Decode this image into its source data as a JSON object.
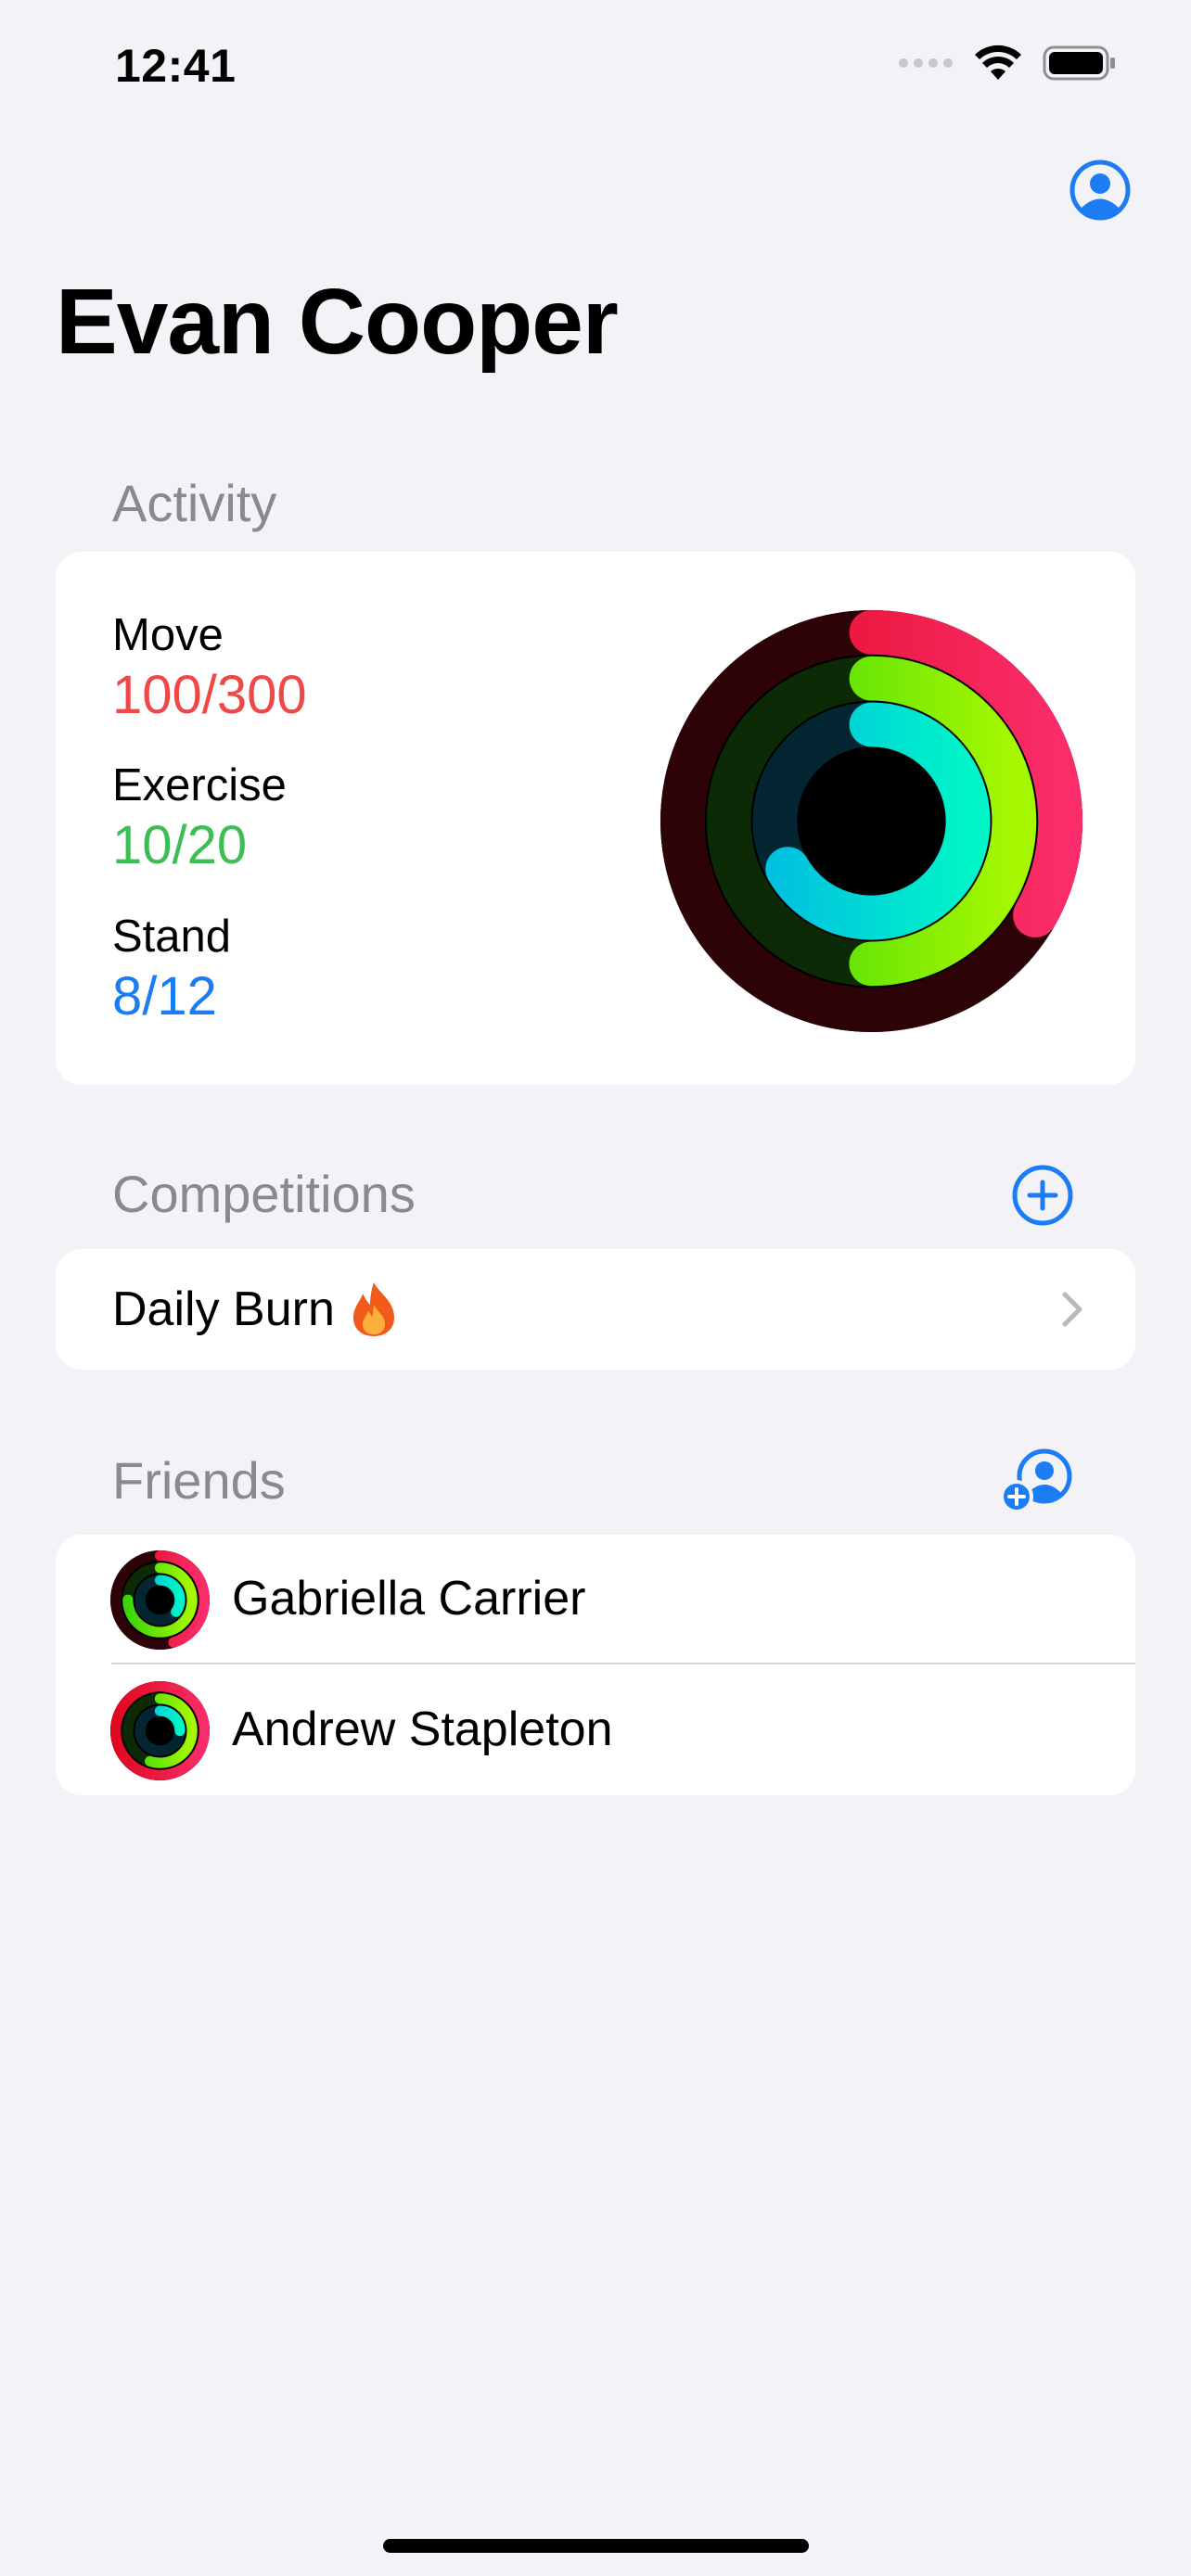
{
  "status_bar": {
    "time": "12:41"
  },
  "colors": {
    "background": "#f2f2f7",
    "accent": "#1c7cf4",
    "move": "#fa2d48",
    "exercise": "#3dd64b",
    "stand": "#1c7cf4",
    "secondary_text": "#8a8a8e"
  },
  "header": {
    "title": "Evan Cooper",
    "profile_icon": "person-circle-icon"
  },
  "activity": {
    "section_title": "Activity",
    "metrics": [
      {
        "label": "Move",
        "value": "100/300",
        "progress": 0.333
      },
      {
        "label": "Exercise",
        "value": "10/20",
        "progress": 0.5
      },
      {
        "label": "Stand",
        "value": "8/12",
        "progress": 0.667
      }
    ]
  },
  "competitions": {
    "section_title": "Competitions",
    "add_icon": "plus-circle-icon",
    "items": [
      {
        "name": "Daily Burn",
        "emoji": "🔥"
      }
    ]
  },
  "friends": {
    "section_title": "Friends",
    "add_icon": "person-add-icon",
    "items": [
      {
        "name": "Gabriella Carrier",
        "rings": [
          0.45,
          0.75,
          0.35
        ]
      },
      {
        "name": "Andrew Stapleton",
        "rings": [
          1.0,
          0.55,
          0.25
        ]
      }
    ]
  }
}
